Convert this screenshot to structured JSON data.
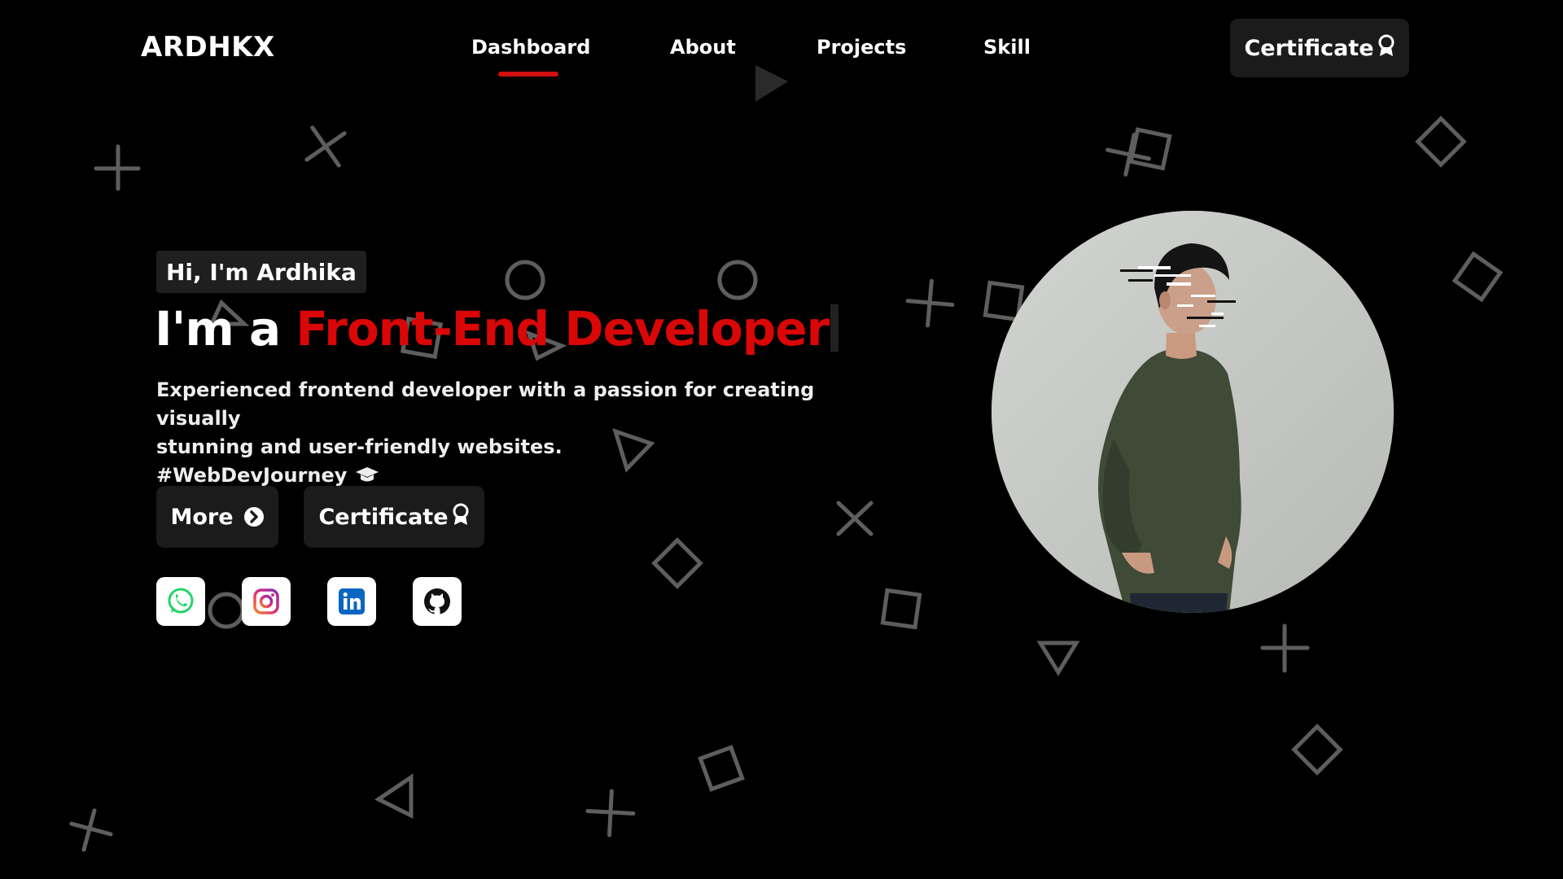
{
  "navbar": {
    "logo": "ARDHKX",
    "items": [
      {
        "label": "Dashboard",
        "active": true
      },
      {
        "label": "About",
        "active": false
      },
      {
        "label": "Projects",
        "active": false
      },
      {
        "label": "Skill",
        "active": false
      }
    ],
    "cert_label": "Certificate",
    "cert_icon": "award-icon"
  },
  "hero": {
    "greeting": "Hi, I'm Ardhika",
    "headline_prefix": "I'm a",
    "headline_role": "Front-End Developer",
    "description_line1": "Experienced frontend developer with a passion for creating visually",
    "description_line2": "stunning and user-friendly websites.",
    "hashtag": "#WebDevJourney",
    "hashtag_icon": "graduation-cap-icon",
    "more_label": "More",
    "more_icon": "chevron-circle-right-icon",
    "cert_label": "Certificate",
    "cert_icon": "award-icon"
  },
  "socials": [
    {
      "name": "whatsapp-icon",
      "color": "#25D366"
    },
    {
      "name": "instagram-icon",
      "color": "#E1306C"
    },
    {
      "name": "linkedin-icon",
      "color": "#0A66C2"
    },
    {
      "name": "github-icon",
      "color": "#000000"
    }
  ],
  "colors": {
    "accent": "#d90707",
    "background": "#000000",
    "button_bg": "#1b1b1b"
  }
}
